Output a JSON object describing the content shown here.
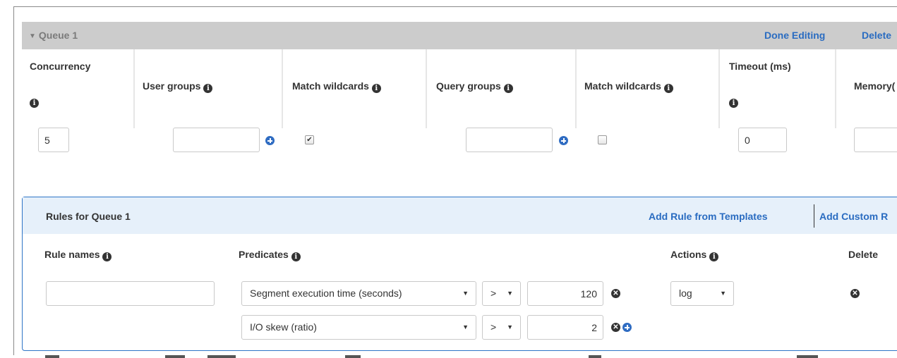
{
  "queue": {
    "title": "Queue 1",
    "done_editing": "Done Editing",
    "delete": "Delete",
    "columns": {
      "concurrency": "Concurrency",
      "user_groups": "User groups",
      "match_wildcards_1": "Match wildcards",
      "query_groups": "Query groups",
      "match_wildcards_2": "Match wildcards",
      "timeout": "Timeout (ms)",
      "memory": "Memory("
    },
    "values": {
      "concurrency": "5",
      "user_groups": "",
      "match_wildcards_1_checked": true,
      "query_groups": "",
      "match_wildcards_2_checked": false,
      "timeout": "0",
      "memory": ""
    }
  },
  "rules": {
    "title": "Rules for Queue 1",
    "add_from_templates": "Add Rule from Templates",
    "add_custom": "Add Custom R",
    "headers": {
      "rule_names": "Rule names",
      "predicates": "Predicates",
      "actions": "Actions",
      "delete": "Delete"
    },
    "rule_name_value": "",
    "predicates": [
      {
        "metric": "Segment execution time (seconds)",
        "operator": ">",
        "value": "120"
      },
      {
        "metric": "I/O skew (ratio)",
        "operator": ">",
        "value": "2"
      }
    ],
    "action": "log"
  },
  "icons": {
    "info": "info-circle-icon",
    "add": "plus-circle-icon",
    "remove": "x-circle-icon",
    "dropdown": "caret-down-icon"
  },
  "colors": {
    "link": "#2a6cc1",
    "queue_bar": "#cccccc",
    "rules_header": "#e6f0fa",
    "rules_border": "#2e74c6"
  }
}
